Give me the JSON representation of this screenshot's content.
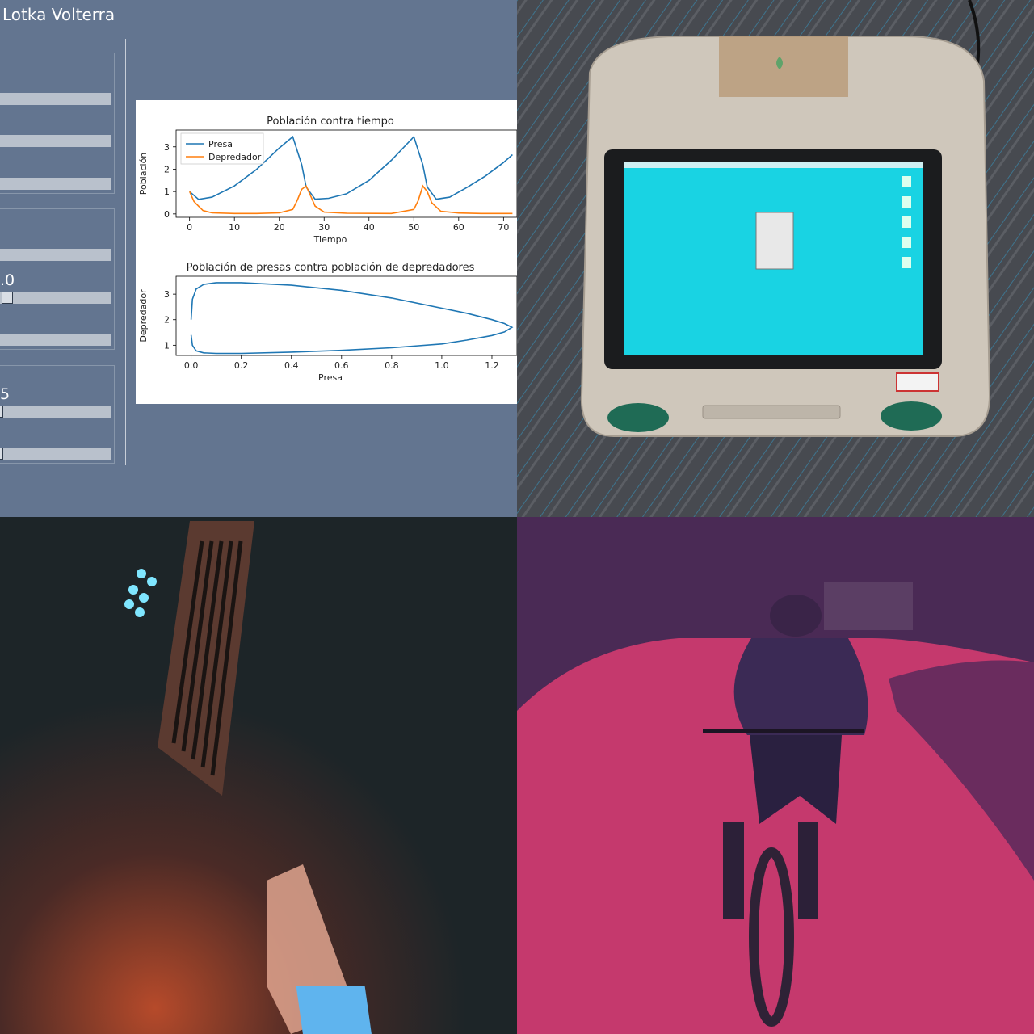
{
  "app": {
    "title": "Lotka Volterra",
    "slider_labels": [
      ".0",
      "5"
    ]
  },
  "chart_data": [
    {
      "type": "line",
      "title": "Población contra tiempo",
      "xlabel": "Tiempo",
      "ylabel": "Población",
      "xlim": [
        -3,
        73
      ],
      "ylim": [
        -0.15,
        3.75
      ],
      "xticks": [
        "0",
        "10",
        "20",
        "30",
        "40",
        "50",
        "60",
        "70"
      ],
      "yticks": [
        "0",
        "1",
        "2",
        "3"
      ],
      "legend": "top-left",
      "series": [
        {
          "name": "Presa",
          "color": "#1f77b4",
          "x": [
            0,
            2,
            5,
            10,
            15,
            20,
            23,
            25,
            26,
            28,
            31,
            35,
            40,
            45,
            50,
            52,
            53,
            55,
            58,
            62,
            66,
            70,
            72
          ],
          "y": [
            1.0,
            0.65,
            0.75,
            1.25,
            2.0,
            2.95,
            3.45,
            2.2,
            1.2,
            0.66,
            0.7,
            0.9,
            1.5,
            2.4,
            3.45,
            2.2,
            1.2,
            0.66,
            0.75,
            1.2,
            1.7,
            2.3,
            2.65
          ]
        },
        {
          "name": "Depredador",
          "color": "#ff7f0e",
          "x": [
            0,
            1,
            3,
            5,
            10,
            15,
            20,
            23,
            24,
            25,
            26,
            27,
            28,
            30,
            35,
            45,
            50,
            51,
            52,
            53,
            54,
            56,
            60,
            65,
            70,
            72
          ],
          "y": [
            1.0,
            0.55,
            0.15,
            0.05,
            0.02,
            0.02,
            0.05,
            0.2,
            0.6,
            1.1,
            1.25,
            0.8,
            0.35,
            0.08,
            0.03,
            0.02,
            0.2,
            0.6,
            1.25,
            1.0,
            0.5,
            0.12,
            0.04,
            0.02,
            0.02,
            0.02
          ]
        }
      ]
    },
    {
      "type": "line",
      "title": "Población de presas contra población de depredadores",
      "xlabel": "Presa",
      "ylabel": "Depredador",
      "xlim": [
        -0.06,
        1.3
      ],
      "ylim": [
        0.6,
        3.7
      ],
      "xticks": [
        "0.0",
        "0.2",
        "0.4",
        "0.6",
        "0.8",
        "1.0",
        "1.2"
      ],
      "yticks": [
        "1",
        "2",
        "3"
      ],
      "series": [
        {
          "color": "#1f77b4",
          "x": [
            0.0,
            0.005,
            0.02,
            0.05,
            0.1,
            0.2,
            0.4,
            0.6,
            0.8,
            1.0,
            1.1,
            1.2,
            1.25,
            1.28,
            1.25,
            1.2,
            1.1,
            1.0,
            0.8,
            0.6,
            0.4,
            0.2,
            0.1,
            0.05,
            0.02,
            0.005,
            0.0
          ],
          "y": [
            2.0,
            2.8,
            3.2,
            3.38,
            3.45,
            3.45,
            3.35,
            3.15,
            2.85,
            2.45,
            2.25,
            2.0,
            1.85,
            1.7,
            1.52,
            1.38,
            1.2,
            1.05,
            0.9,
            0.8,
            0.73,
            0.68,
            0.68,
            0.7,
            0.78,
            1.0,
            1.4
          ]
        }
      ]
    }
  ]
}
